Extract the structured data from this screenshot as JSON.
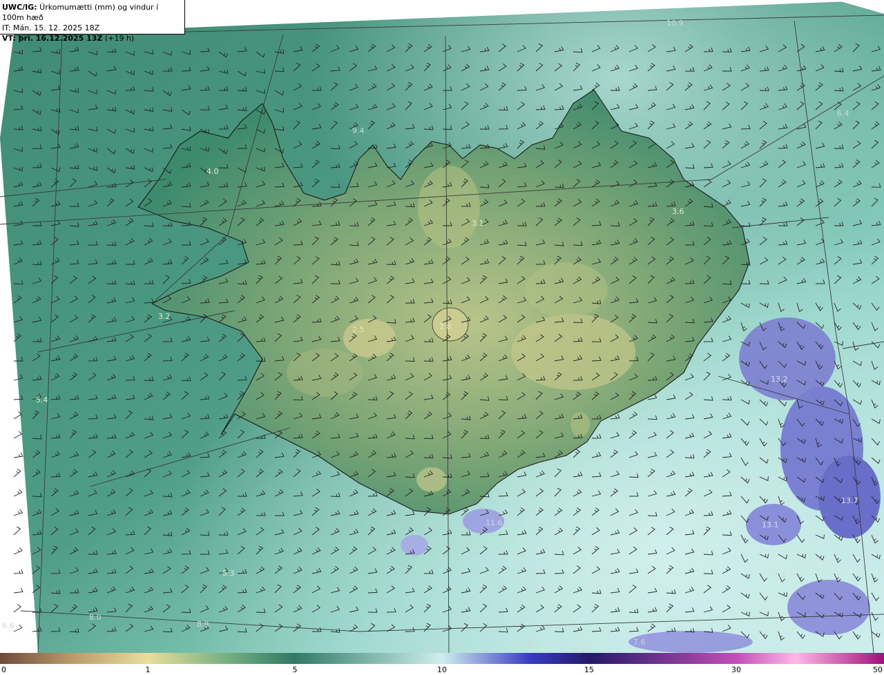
{
  "info": {
    "line1_bold": "UWC/IG:",
    "line1_text": " Úrkomumætti (mm) og vindur í 100m hæð",
    "line2": "IT: Mán. 15. 12. 2025 18Z",
    "line3_bold": "VT: þri. 16.12.2025 13Z",
    "line3_text": " (+19 h)"
  },
  "colorbar": {
    "ticks": [
      "0",
      "1",
      "5",
      "10",
      "15",
      "30",
      "50"
    ],
    "colors": [
      "#6e4b3a",
      "#b99a6a",
      "#e8df9a",
      "#7fb383",
      "#2f7a66",
      "#cfeeee",
      "#3a3ac2",
      "#241a6a",
      "#c24fb8",
      "#ffd0f0"
    ]
  },
  "map_values": [
    {
      "text": "10.9",
      "color": "#cfd8d8"
    },
    {
      "text": "6.4",
      "color": "#cfd8d8"
    },
    {
      "text": "9.4",
      "color": "#cfd8d8"
    },
    {
      "text": "4.0",
      "color": "#e8e8c8"
    },
    {
      "text": "3.6",
      "color": "#e8e8c8"
    },
    {
      "text": "3.1",
      "color": "#e8e8c8"
    },
    {
      "text": "3.2",
      "color": "#e8e8c8"
    },
    {
      "text": "2.5",
      "color": "#e8e8c8"
    },
    {
      "text": "2.8",
      "color": "#e8e8c8"
    },
    {
      "text": "5.4",
      "color": "#e8e8c8"
    },
    {
      "text": "13.2",
      "color": "#dcdcf4"
    },
    {
      "text": "13.7",
      "color": "#dcdcf4"
    },
    {
      "text": "11.6",
      "color": "#cfd8d8"
    },
    {
      "text": "13.1",
      "color": "#dcdcf4"
    },
    {
      "text": "7.3",
      "color": "#cfd8d8"
    },
    {
      "text": "5.3",
      "color": "#e8e8c8"
    },
    {
      "text": "8.0",
      "color": "#cfd8d8"
    },
    {
      "text": "6.6",
      "color": "#cfd8d8"
    },
    {
      "text": "8.9",
      "color": "#cfd8d8"
    },
    {
      "text": "9.1",
      "color": "#cfd8d8"
    },
    {
      "text": "8.4",
      "color": "#cfd8d8"
    },
    {
      "text": "7.7",
      "color": "#cfd8d8"
    },
    {
      "text": "7.6",
      "color": "#cfd8d8"
    }
  ]
}
